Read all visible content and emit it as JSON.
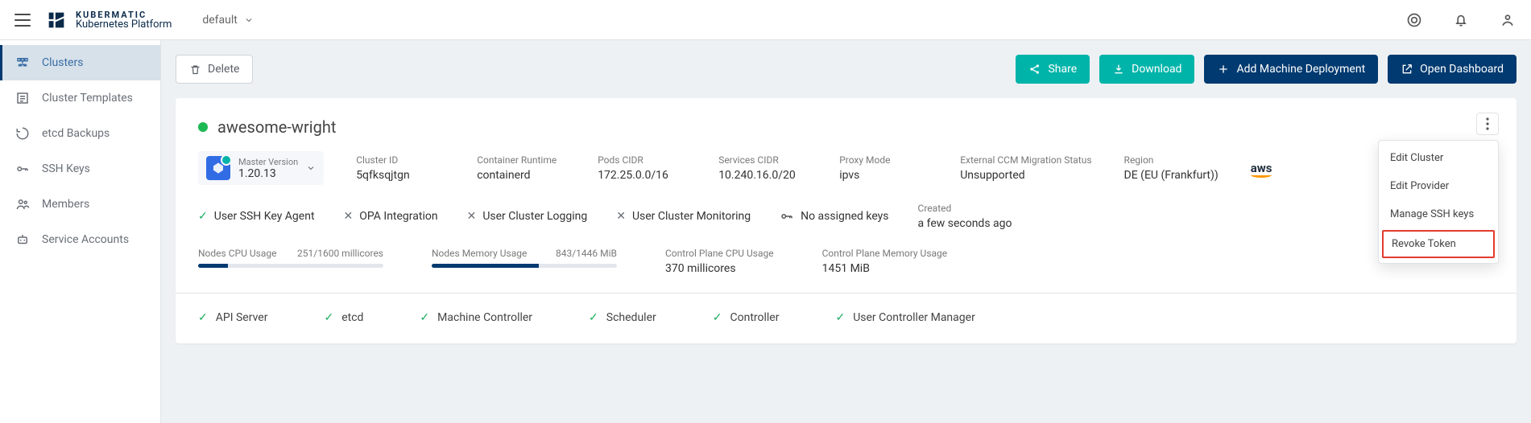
{
  "header": {
    "brand_top": "KUBERMATIC",
    "brand_sub": "Kubernetes Platform",
    "project": "default"
  },
  "sidebar": {
    "items": [
      {
        "label": "Clusters",
        "active": true
      },
      {
        "label": "Cluster Templates"
      },
      {
        "label": "etcd Backups"
      },
      {
        "label": "SSH Keys"
      },
      {
        "label": "Members"
      },
      {
        "label": "Service Accounts"
      }
    ]
  },
  "toolbar": {
    "delete": "Delete",
    "share": "Share",
    "download": "Download",
    "add": "Add Machine Deployment",
    "open": "Open Dashboard"
  },
  "cluster": {
    "name": "awesome-wright",
    "master_version_label": "Master Version",
    "master_version": "1.20.13",
    "cluster_id_label": "Cluster ID",
    "cluster_id": "5qfksqjtgn",
    "runtime_label": "Container Runtime",
    "runtime": "containerd",
    "pods_cidr_label": "Pods CIDR",
    "pods_cidr": "172.25.0.0/16",
    "services_cidr_label": "Services CIDR",
    "services_cidr": "10.240.16.0/20",
    "proxy_mode_label": "Proxy Mode",
    "proxy_mode": "ipvs",
    "ccm_label": "External CCM Migration Status",
    "ccm": "Unsupported",
    "region_label": "Region",
    "region": "DE (EU (Frankfurt))",
    "provider": "aws",
    "created_label": "Created",
    "created": "a few seconds ago"
  },
  "flags": {
    "sshagent": "User SSH Key Agent",
    "opa": "OPA Integration",
    "logging": "User Cluster Logging",
    "monitoring": "User Cluster Monitoring",
    "keys": "No assigned keys"
  },
  "usage": {
    "cpu_label": "Nodes CPU Usage",
    "cpu_value": "251/1600 millicores",
    "cpu_pct": 16,
    "mem_label": "Nodes Memory Usage",
    "mem_value": "843/1446 MiB",
    "mem_pct": 58,
    "cp_cpu_label": "Control Plane CPU Usage",
    "cp_cpu": "370 millicores",
    "cp_mem_label": "Control Plane Memory Usage",
    "cp_mem": "1451 MiB"
  },
  "health": {
    "api": "API Server",
    "etcd": "etcd",
    "mc": "Machine Controller",
    "sched": "Scheduler",
    "ctrl": "Controller",
    "ucm": "User Controller Manager"
  },
  "menu": {
    "edit_cluster": "Edit Cluster",
    "edit_provider": "Edit Provider",
    "manage_ssh": "Manage SSH keys",
    "revoke": "Revoke Token"
  }
}
